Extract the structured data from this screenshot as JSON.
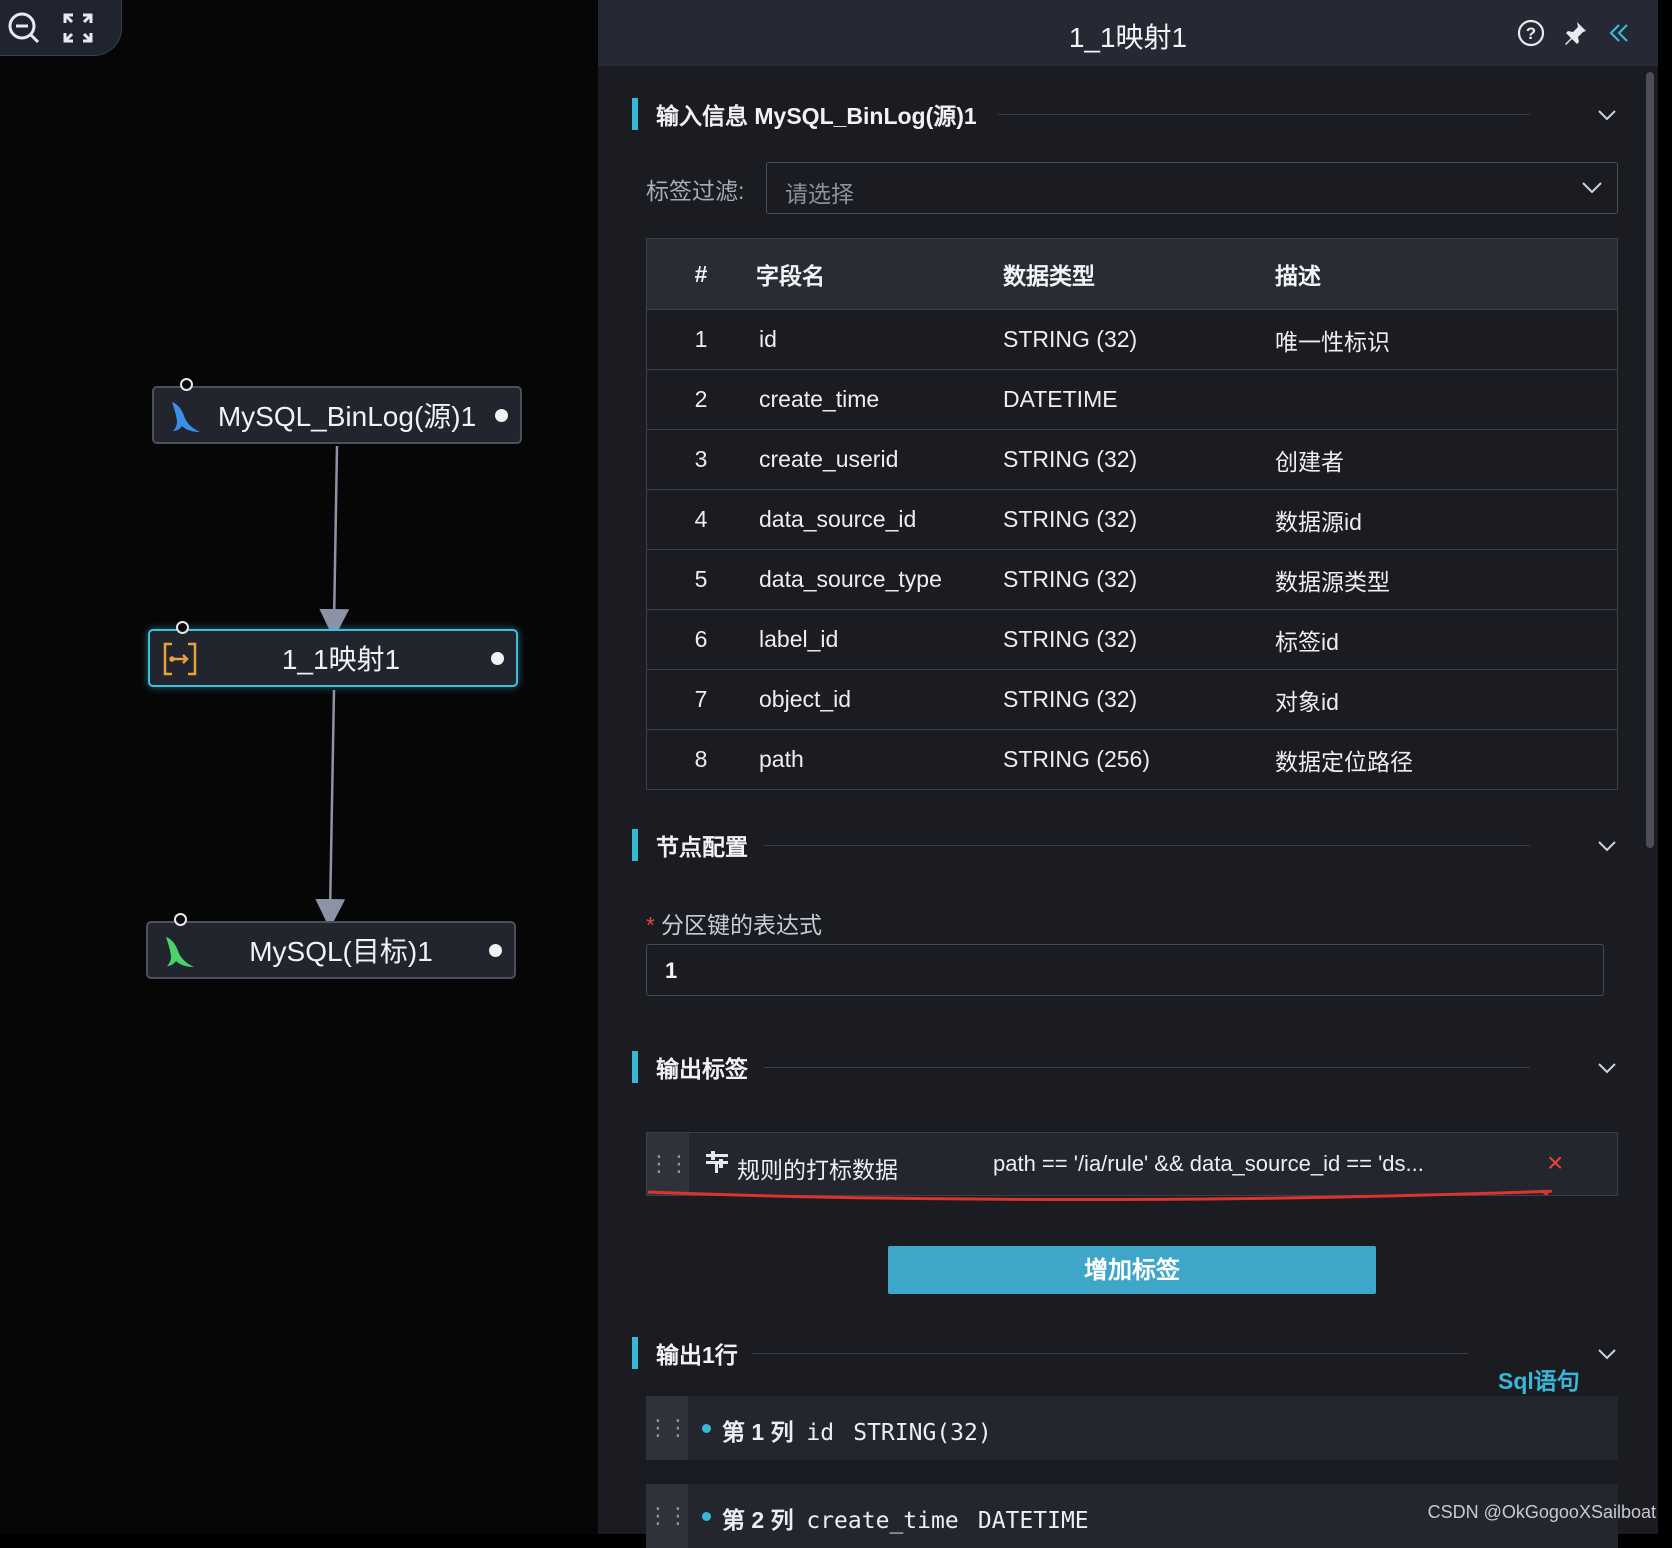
{
  "canvas": {
    "toolbar": {
      "zoom_icon": "zoom-out-icon",
      "fit_icon": "fullscreen-icon"
    },
    "nodes": [
      {
        "label": "MySQL_BinLog(源)1",
        "icon": "mysql-dolphin-icon",
        "icon_color": "#3d8fe6"
      },
      {
        "label": "1_1映射1",
        "icon": "mapping-icon",
        "icon_color": "#e8a13a",
        "selected": true
      },
      {
        "label": "MySQL(目标)1",
        "icon": "mysql-dolphin-icon",
        "icon_color": "#4bd36b"
      }
    ]
  },
  "panel": {
    "title": "1_1映射1",
    "header_icons": [
      "help-icon",
      "pin-icon",
      "collapse-icon"
    ],
    "input_section": {
      "title": "输入信息 MySQL_BinLog(源)1",
      "filter_label": "标签过滤:",
      "filter_placeholder": "请选择",
      "columns": [
        "#",
        "字段名",
        "数据类型",
        "描述"
      ],
      "rows": [
        [
          "1",
          "id",
          "STRING (32)",
          "唯一性标识"
        ],
        [
          "2",
          "create_time",
          "DATETIME",
          ""
        ],
        [
          "3",
          "create_userid",
          "STRING (32)",
          "创建者"
        ],
        [
          "4",
          "data_source_id",
          "STRING (32)",
          "数据源id"
        ],
        [
          "5",
          "data_source_type",
          "STRING (32)",
          "数据源类型"
        ],
        [
          "6",
          "label_id",
          "STRING (32)",
          "标签id"
        ],
        [
          "7",
          "object_id",
          "STRING (32)",
          "对象id"
        ],
        [
          "8",
          "path",
          "STRING (256)",
          "数据定位路径"
        ]
      ]
    },
    "node_config": {
      "title": "节点配置",
      "partition_label": "分区键的表达式",
      "partition_value": "1"
    },
    "output_tags": {
      "title": "输出标签",
      "tag_name": "规则的打标数据",
      "tag_expr": "path == '/ia/rule' && data_source_id == 'ds...",
      "add_button": "增加标签"
    },
    "output_rows": {
      "title": "输出1行",
      "sql_link": "Sql语句",
      "items": [
        {
          "prefix": "第 1 列",
          "field": "id",
          "type": "STRING(32)"
        },
        {
          "prefix": "第 2 列",
          "field": "create_time",
          "type": "DATETIME"
        }
      ]
    }
  },
  "watermark": "CSDN @OkGogooXSailboat",
  "colors": {
    "accent": "#39b7d6",
    "selected_border": "#3fc0d8",
    "danger": "#e5473c"
  }
}
